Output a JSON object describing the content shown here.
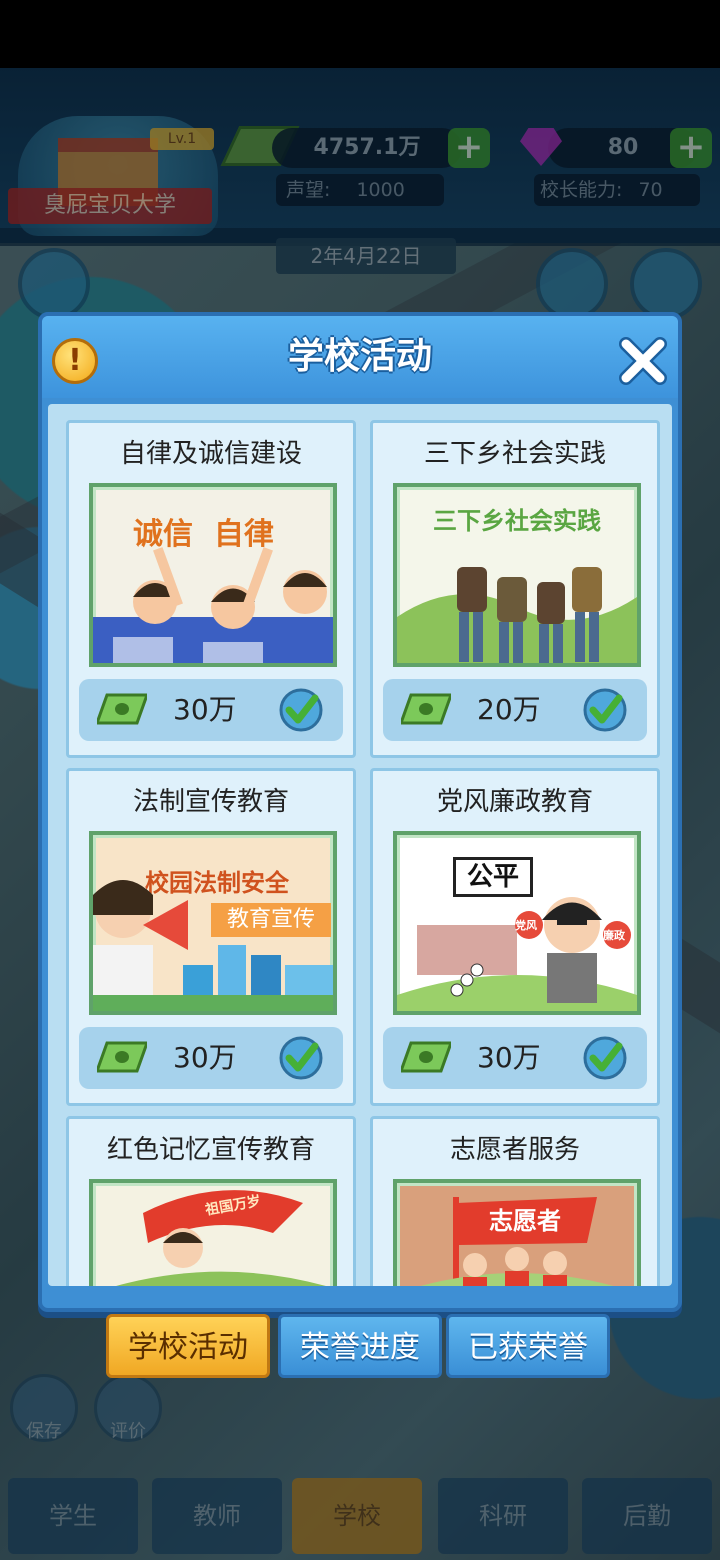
{
  "hud": {
    "school_name": "臭屁宝贝大学",
    "level": "Lv.1",
    "money": "4757.1万",
    "gems": "80",
    "reputation_label": "声望:",
    "reputation_value": "1000",
    "ability_label": "校长能力:",
    "ability_value": "70",
    "date": "2年4月22日"
  },
  "panel": {
    "title": "学校活动",
    "info_icon": "!",
    "activities": [
      {
        "name": "自律及诚信建设",
        "poster_text": "诚信  自律",
        "cost": "30万",
        "done": true
      },
      {
        "name": "三下乡社会实践",
        "poster_text": "三下乡社会实践",
        "cost": "20万",
        "done": true
      },
      {
        "name": "法制宣传教育",
        "poster_text": "校园法制安全",
        "poster_text2": "教育宣传",
        "cost": "30万",
        "done": true
      },
      {
        "name": "党风廉政教育",
        "poster_text": "公平",
        "poster_sign1": "党风",
        "poster_sign2": "廉政",
        "cost": "30万",
        "done": true
      },
      {
        "name": "红色记忆宣传教育",
        "poster_text": "祖国万岁"
      },
      {
        "name": "志愿者服务",
        "poster_text": "志愿者"
      }
    ]
  },
  "tabs": [
    {
      "label": "学校活动",
      "active": true
    },
    {
      "label": "荣誉进度",
      "active": false
    },
    {
      "label": "已获荣誉",
      "active": false
    }
  ],
  "side_buttons": {
    "save": "保存",
    "rate": "评价"
  },
  "bottom_nav": [
    {
      "label": "学生"
    },
    {
      "label": "教师"
    },
    {
      "label": "学校"
    },
    {
      "label": "科研"
    },
    {
      "label": "后勤"
    }
  ],
  "colors": {
    "accent_blue": "#3e8fd4",
    "tab_active": "#f0a824",
    "check_green": "#46b036"
  }
}
